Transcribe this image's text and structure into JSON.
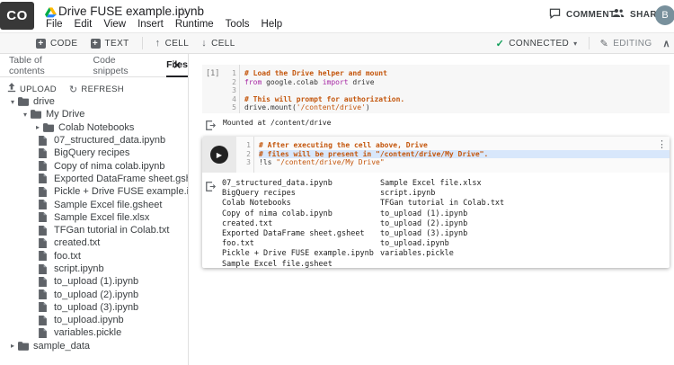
{
  "header": {
    "logo_text": "CO",
    "title": "Drive FUSE example.ipynb",
    "menu": [
      "File",
      "Edit",
      "View",
      "Insert",
      "Runtime",
      "Tools",
      "Help"
    ],
    "comment_label": "COMMENT",
    "share_label": "SHARE",
    "avatar_initial": "B"
  },
  "toolbar": {
    "code_label": "CODE",
    "text_label": "TEXT",
    "cell_up_label": "CELL",
    "cell_down_label": "CELL",
    "connected_label": "CONNECTED",
    "editing_label": "EDITING"
  },
  "panel": {
    "tabs": [
      {
        "label": "Table of contents",
        "active": false
      },
      {
        "label": "Code snippets",
        "active": false
      },
      {
        "label": "Files",
        "active": true
      }
    ],
    "upload_label": "UPLOAD",
    "refresh_label": "REFRESH",
    "tree": [
      {
        "label": "drive",
        "type": "folder",
        "depth": 0,
        "expanded": true
      },
      {
        "label": "My Drive",
        "type": "folder",
        "depth": 1,
        "expanded": true
      },
      {
        "label": "Colab Notebooks",
        "type": "folder",
        "depth": 2,
        "expanded": false
      },
      {
        "label": "07_structured_data.ipynb",
        "type": "file",
        "depth": 2
      },
      {
        "label": "BigQuery recipes",
        "type": "file",
        "depth": 2
      },
      {
        "label": "Copy of nima colab.ipynb",
        "type": "file",
        "depth": 2
      },
      {
        "label": "Exported DataFrame sheet.gsheet",
        "type": "file",
        "depth": 2
      },
      {
        "label": "Pickle + Drive FUSE example.ipynb",
        "type": "file",
        "depth": 2
      },
      {
        "label": "Sample Excel file.gsheet",
        "type": "file",
        "depth": 2
      },
      {
        "label": "Sample Excel file.xlsx",
        "type": "file",
        "depth": 2
      },
      {
        "label": "TFGan tutorial in Colab.txt",
        "type": "file",
        "depth": 2
      },
      {
        "label": "created.txt",
        "type": "file",
        "depth": 2
      },
      {
        "label": "foo.txt",
        "type": "file",
        "depth": 2
      },
      {
        "label": "script.ipynb",
        "type": "file",
        "depth": 2
      },
      {
        "label": "to_upload (1).ipynb",
        "type": "file",
        "depth": 2
      },
      {
        "label": "to_upload (2).ipynb",
        "type": "file",
        "depth": 2
      },
      {
        "label": "to_upload (3).ipynb",
        "type": "file",
        "depth": 2
      },
      {
        "label": "to_upload.ipynb",
        "type": "file",
        "depth": 2
      },
      {
        "label": "variables.pickle",
        "type": "file",
        "depth": 2
      },
      {
        "label": "sample_data",
        "type": "folder",
        "depth": 0,
        "expanded": false
      }
    ]
  },
  "notebook": {
    "cell1": {
      "exec_count": "[1]",
      "lines": [
        [
          {
            "t": "# Load the Drive helper and mount",
            "c": "comment"
          }
        ],
        [
          {
            "t": "from",
            "c": "keyword"
          },
          {
            "t": " google.colab ",
            "c": "plain"
          },
          {
            "t": "import",
            "c": "keyword"
          },
          {
            "t": " drive",
            "c": "plain"
          }
        ],
        [],
        [
          {
            "t": "# This will prompt for authorization.",
            "c": "comment"
          }
        ],
        [
          {
            "t": "drive.mount(",
            "c": "plain"
          },
          {
            "t": "'/content/drive'",
            "c": "string"
          },
          {
            "t": ")",
            "c": "plain"
          }
        ]
      ],
      "output": "Mounted at /content/drive"
    },
    "cell2": {
      "highlight_line": 2,
      "lines": [
        [
          {
            "t": "# After executing the cell above, Drive",
            "c": "comment"
          }
        ],
        [
          {
            "t": "# files will be present in \"/content/drive/My Drive\".",
            "c": "comment"
          }
        ],
        [
          {
            "t": "!ls ",
            "c": "plain"
          },
          {
            "t": "\"/content/drive/My Drive\"",
            "c": "string"
          }
        ]
      ],
      "output_columns": [
        [
          "07_structured_data.ipynb",
          "BigQuery recipes",
          "Colab Notebooks",
          "Copy of nima colab.ipynb",
          "created.txt",
          "Exported DataFrame sheet.gsheet",
          "foo.txt",
          "Pickle + Drive FUSE example.ipynb",
          "Sample Excel file.gsheet"
        ],
        [
          "Sample Excel file.xlsx",
          "script.ipynb",
          "TFGan tutorial in Colab.txt",
          "to_upload (1).ipynb",
          "to_upload (2).ipynb",
          "to_upload (3).ipynb",
          "to_upload.ipynb",
          "variables.pickle"
        ]
      ]
    }
  },
  "icons": {
    "star": "☆",
    "check": "✓",
    "pencil": "✎",
    "dropdown_caret": "▾",
    "collapse": "∧",
    "kebab": "⋮",
    "play": "▶",
    "close": "×",
    "refresh": "↻",
    "plus": "+",
    "arrow_up": "↑",
    "arrow_down": "↓",
    "tree_expanded": "▾",
    "tree_collapsed": "▸"
  },
  "colors": {
    "logo_bg": "#383838",
    "connected_green": "#0F9D58",
    "avatar_bg": "#78909c",
    "cell_bg": "#f7f7f7",
    "focused_gutter_bg": "#e9e9e9",
    "current_line_highlight": "#d8e7fb",
    "syntax_comment": "#C4560C",
    "syntax_keyword": "#A626A4",
    "syntax_string": "#C4560C",
    "drive_green": "#00AC47",
    "drive_yellow": "#FFBA00",
    "drive_blue": "#2684FC"
  }
}
